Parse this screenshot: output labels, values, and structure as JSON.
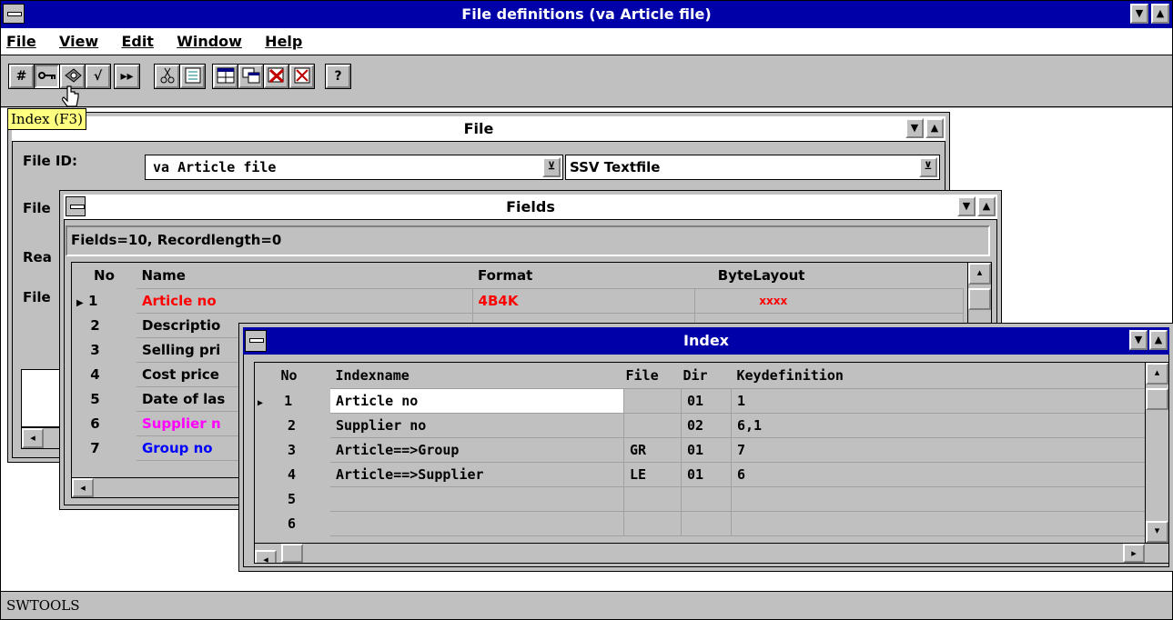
{
  "app": {
    "title": "File definitions (va Article file)",
    "menu": [
      "File",
      "View",
      "Edit",
      "Window",
      "Help"
    ],
    "tooltip": "Index (F3)",
    "status": "SWTOOLS"
  },
  "toolbar": {
    "group1": [
      "#",
      "key",
      "disk",
      "√"
    ],
    "group2": [
      "▸▸"
    ],
    "group3": [
      "cut",
      "doc"
    ],
    "group4": [
      "win1",
      "win2",
      "win3",
      "win4"
    ],
    "group5": [
      "?"
    ]
  },
  "file_window": {
    "title": "File",
    "labels": [
      "File ID:",
      "File",
      "Rea",
      "File"
    ],
    "file_id_value": "va  Article file",
    "type_value": "SSV Textfile"
  },
  "fields_window": {
    "title": "Fields",
    "summary": "Fields=10, Recordlength=0",
    "columns": [
      "No",
      "Name",
      "Format",
      "ByteLayout"
    ],
    "rows": [
      {
        "no": "1",
        "name": "Article no",
        "format": "4B4K",
        "layout": "xxxx",
        "color": "#ff0000"
      },
      {
        "no": "2",
        "name": "Descriptio",
        "format": "",
        "layout": "",
        "color": "#000000"
      },
      {
        "no": "3",
        "name": "Selling pri",
        "format": "",
        "layout": "",
        "color": "#000000"
      },
      {
        "no": "4",
        "name": "Cost price",
        "format": "",
        "layout": "",
        "color": "#000000"
      },
      {
        "no": "5",
        "name": "Date of las",
        "format": "",
        "layout": "",
        "color": "#000000"
      },
      {
        "no": "6",
        "name": "Supplier n",
        "format": "",
        "layout": "",
        "color": "#ff00ff"
      },
      {
        "no": "7",
        "name": "Group no",
        "format": "",
        "layout": "",
        "color": "#0000ff"
      }
    ]
  },
  "index_window": {
    "title": "Index",
    "columns": [
      "No",
      "Indexname",
      "File",
      "Dir",
      "Keydefinition"
    ],
    "rows": [
      {
        "no": "1",
        "name": "Article no",
        "file": "",
        "dir": "01",
        "key": "1"
      },
      {
        "no": "2",
        "name": "Supplier no",
        "file": "",
        "dir": "02",
        "key": "6,1"
      },
      {
        "no": "3",
        "name": "Article==>Group",
        "file": "GR",
        "dir": "01",
        "key": "7"
      },
      {
        "no": "4",
        "name": "Article==>Supplier",
        "file": "LE",
        "dir": "01",
        "key": "6"
      },
      {
        "no": "5",
        "name": "",
        "file": "",
        "dir": "",
        "key": ""
      },
      {
        "no": "6",
        "name": "",
        "file": "",
        "dir": "",
        "key": ""
      }
    ]
  }
}
